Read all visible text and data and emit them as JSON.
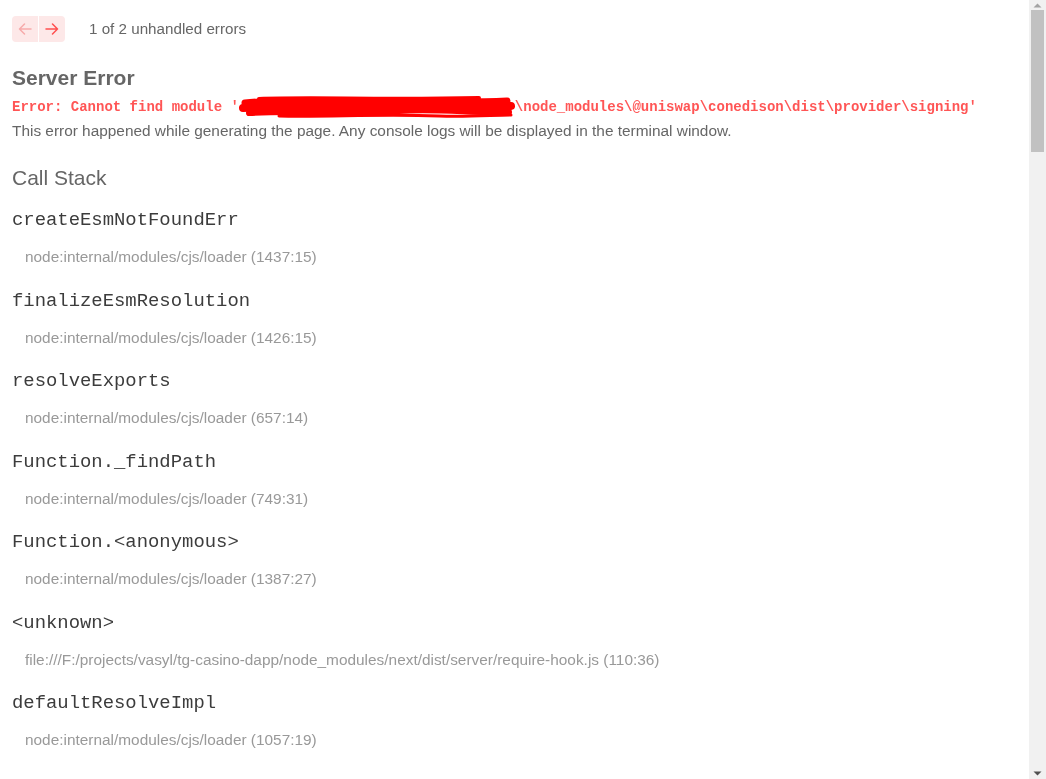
{
  "navigation": {
    "buttons": [
      {
        "kind": "previous",
        "disabled": true
      },
      {
        "kind": "next",
        "disabled": false
      }
    ],
    "counter": "1 of 2 unhandled errors"
  },
  "error": {
    "title": "Server Error",
    "message": "Error: Cannot find module '",
    "message_end": "\\node_modules\\@uniswap\\conedison\\dist\\provider\\signing'",
    "description": "This error happened while generating the page. Any console logs will be displayed in the terminal window."
  },
  "call_stack": {
    "title": "Call Stack",
    "frames": [
      {
        "function": "createEsmNotFoundErr",
        "location": "node:internal/modules/cjs/loader (1437:15)"
      },
      {
        "function": "finalizeEsmResolution",
        "location": "node:internal/modules/cjs/loader (1426:15)"
      },
      {
        "function": "resolveExports",
        "location": "node:internal/modules/cjs/loader (657:14)"
      },
      {
        "function": "Function._findPath",
        "location": "node:internal/modules/cjs/loader (749:31)"
      },
      {
        "function": "Function.<anonymous>",
        "location": "node:internal/modules/cjs/loader (1387:27)"
      },
      {
        "function": "<unknown>",
        "location": "file:///F:/projects/vasyl/tg-casino-dapp/node_modules/next/dist/server/require-hook.js (110:36)"
      },
      {
        "function": "defaultResolveImpl",
        "location": "node:internal/modules/cjs/loader (1057:19)"
      }
    ]
  }
}
